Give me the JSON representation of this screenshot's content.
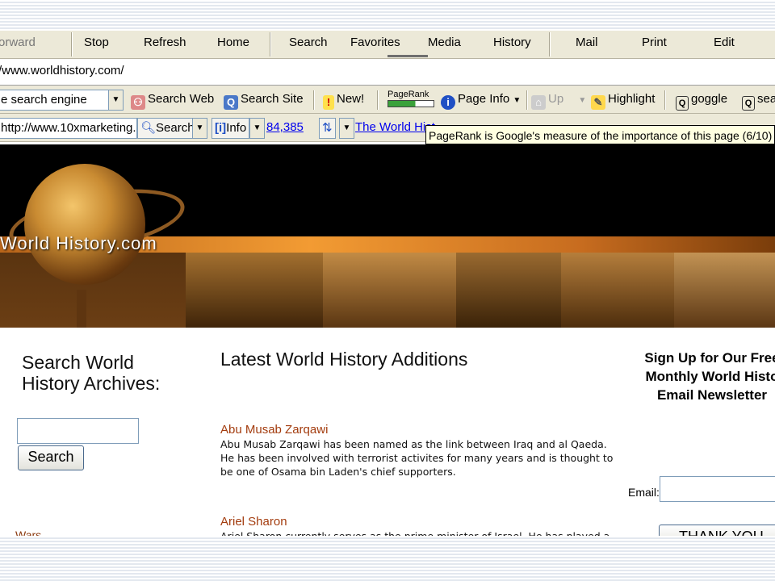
{
  "menu": {
    "forward": "orward",
    "stop": "Stop",
    "refresh": "Refresh",
    "home": "Home",
    "search": "Search",
    "favorites": "Favorites",
    "media": "Media",
    "history": "History",
    "mail": "Mail",
    "print": "Print",
    "edit": "Edit"
  },
  "address": {
    "url": "/www.worldhistory.com/"
  },
  "toolbar1": {
    "engine_value": "e search engine",
    "search_web": "Search Web",
    "search_site": "Search Site",
    "new": "New!",
    "pagerank": "PageRank",
    "page_info": "Page Info",
    "up": "Up",
    "highlight": "Highlight",
    "goggle": "goggle",
    "sea": "sea"
  },
  "toolbar2": {
    "url_value": "http://www.10xmarketing.c",
    "search": "Search",
    "info": "Info",
    "count": "84,385",
    "history_link": "The World Hist",
    "tooltip": "PageRank is Google's measure of the importance of this page (6/10)"
  },
  "banner": {
    "title": "World History.com"
  },
  "search_panel": {
    "heading_line1": "Search World",
    "heading_line2": "History Archives:",
    "input_value": "",
    "button": "Search",
    "link_wars": "Wars"
  },
  "latest": {
    "heading": "Latest World History Additions",
    "articles": [
      {
        "title": "Abu Musab Zarqawi",
        "body": "Abu Musab Zarqawi has been named as the link between Iraq and al Qaeda. He has been involved with terrorist activites for many years and is thought to be one of Osama bin Laden's chief supporters."
      },
      {
        "title": "Ariel Sharon",
        "body": "Ariel Sharon currently serves as the prime minister of Israel. He has played a role in the Israeli-Palestinian conflict for many years."
      }
    ]
  },
  "newsletter": {
    "line1": "Sign Up for Our Free",
    "line2": "Monthly World Histo",
    "line3": "Email Newsletter",
    "email_label": "Email:",
    "email_value": "",
    "button": "THANK YOU"
  }
}
